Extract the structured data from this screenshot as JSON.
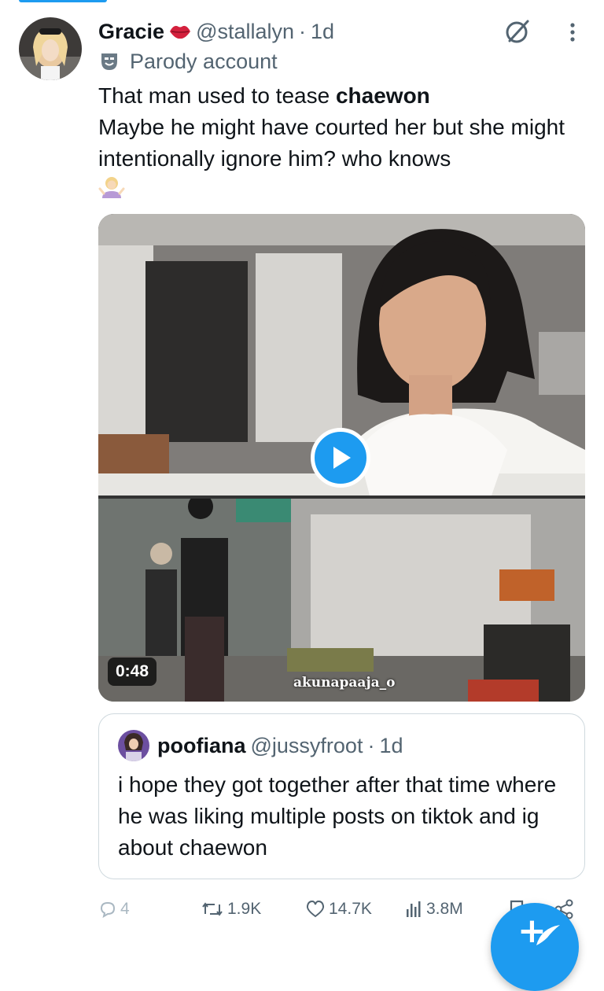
{
  "post": {
    "display_name": "Gracie",
    "handle": "@stallalyn",
    "separator": "·",
    "time": "1d",
    "account_label": "Parody account",
    "text_part1": "That man used to tease ",
    "text_bold": "chaewon",
    "text_part2": "Maybe he might have courted her but she might intentionally ignore him? who knows",
    "emoji_icon": "woman-shrugging-emoji"
  },
  "media": {
    "duration": "0:48",
    "watermark": "akunapaaja_o",
    "play_icon": "play-icon"
  },
  "quote": {
    "display_name": "poofiana",
    "handle": "@jussyfroot",
    "separator": "·",
    "time": "1d",
    "text": "i hope they got together after that time where he was liking multiple posts on tiktok and ig about chaewon"
  },
  "actions": {
    "replies": "4",
    "reposts": "1.9K",
    "likes": "14.7K",
    "views": "3.8M"
  },
  "colors": {
    "accent": "#1d9bf0",
    "muted_text": "#536471",
    "border": "#cfd9de",
    "lips_emoji": "#d4213d"
  }
}
